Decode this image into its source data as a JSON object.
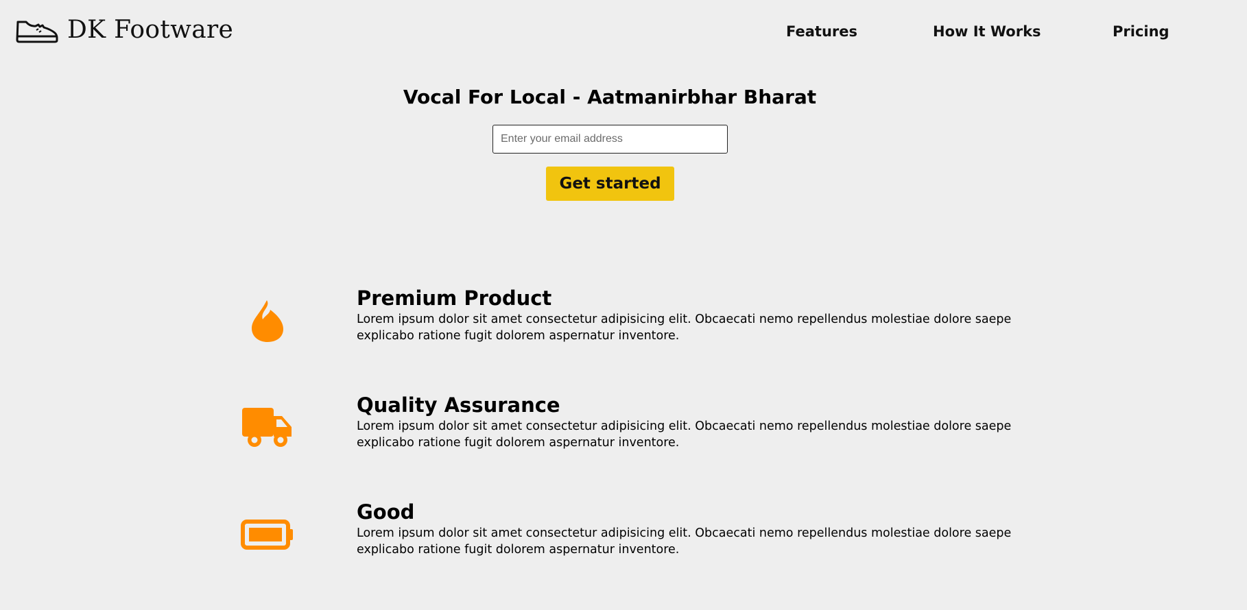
{
  "brand": {
    "name": "DK Footware",
    "logo_icon": "sneaker-icon"
  },
  "nav": {
    "items": [
      {
        "label": "Features"
      },
      {
        "label": "How It Works"
      },
      {
        "label": "Pricing"
      }
    ]
  },
  "hero": {
    "title": "Vocal For Local - Aatmanirbhar Bharat",
    "email_placeholder": "Enter your email address",
    "email_value": "",
    "cta_label": "Get started"
  },
  "features": [
    {
      "icon": "fire-icon",
      "title": "Premium Product",
      "description": "Lorem ipsum dolor sit amet consectetur adipisicing elit. Obcaecati nemo repellendus molestiae dolore saepe explicabo ratione fugit dolorem aspernatur inventore."
    },
    {
      "icon": "truck-icon",
      "title": "Quality Assurance",
      "description": "Lorem ipsum dolor sit amet consectetur adipisicing elit. Obcaecati nemo repellendus molestiae dolore saepe explicabo ratione fugit dolorem aspernatur inventore."
    },
    {
      "icon": "battery-full-icon",
      "title": "Good",
      "description": "Lorem ipsum dolor sit amet consectetur adipisicing elit. Obcaecati nemo repellendus molestiae dolore saepe explicabo ratione fugit dolorem aspernatur inventore."
    }
  ],
  "colors": {
    "background": "#eeeeee",
    "accent_button": "#f1c40f",
    "icon_orange": "#ff8c00",
    "text": "#111111"
  }
}
